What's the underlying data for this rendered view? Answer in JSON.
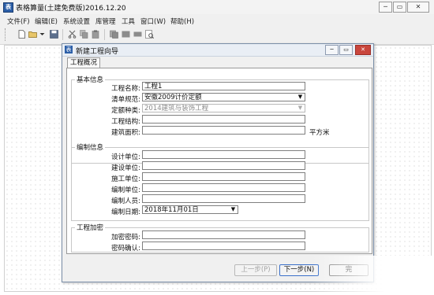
{
  "app": {
    "title": "表格算量(土建免费版)2016.12.20"
  },
  "window_controls": {
    "minimize": "─",
    "restore": "▭",
    "close": "✕"
  },
  "menu": [
    {
      "label": "文件(F)"
    },
    {
      "label": "编辑(E)"
    },
    {
      "label": "系统设置"
    },
    {
      "label": "库管理"
    },
    {
      "label": "工具"
    },
    {
      "label": "窗口(W)"
    },
    {
      "label": "帮助(H)"
    }
  ],
  "toolbar": {
    "icons": [
      "new-file-icon",
      "open-folder-icon",
      "dropdown-arrow-icon",
      "save-icon",
      "cut-icon",
      "copy-icon",
      "paste-icon",
      "clipboard-icon",
      "block-icon",
      "block-icon",
      "print-preview-icon"
    ]
  },
  "dialog": {
    "title": "新建工程向导",
    "tab": "工程概况",
    "basic": {
      "title": "基本信息",
      "project_name_label": "工程名称:",
      "project_name_value": "工程1",
      "bill_spec_label": "清单规范:",
      "bill_spec_value": "安徽2009计价定额",
      "quota_type_label": "定额种类:",
      "quota_type_value": "2014建筑与装饰工程",
      "structure_label": "工程结构:",
      "structure_value": "",
      "area_label": "建筑面积:",
      "area_value": "",
      "area_unit": "平方米"
    },
    "compile": {
      "title": "编制信息",
      "design_unit_label": "设计单位:",
      "build_unit_label": "建设单位:",
      "construct_unit_label": "施工单位:",
      "compile_unit_label": "编制单位:",
      "compiler_label": "编制人员:",
      "compile_date_label": "编制日期:",
      "compile_date_value": "2018年11月01日"
    },
    "encrypt": {
      "title": "工程加密",
      "password_label": "加密密码:",
      "confirm_label": "密码确认:"
    },
    "buttons": {
      "prev": "上一步(P)",
      "next": "下一步(N)",
      "finish": "完"
    }
  },
  "colors": {
    "accent": "#2c5fa8",
    "close_red": "#c9463d"
  }
}
